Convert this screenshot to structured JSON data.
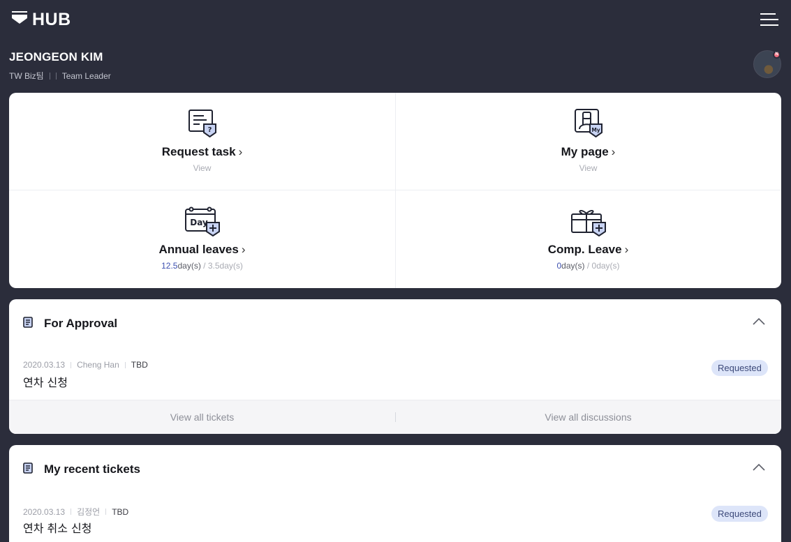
{
  "app": {
    "logo_text": "HUB",
    "logo_icon": "hub-logo-icon",
    "menu_icon": "hamburger-menu-icon"
  },
  "profile": {
    "name": "JEONGEON KIM",
    "team": "TW Biz팀",
    "role": "Team Leader",
    "avatar_badge": "N"
  },
  "quick_links": [
    {
      "title": "Request task",
      "sub": "View",
      "icon": "request-task-icon"
    },
    {
      "title": "My page",
      "sub": "View",
      "icon": "my-page-icon",
      "icon_text": "My"
    },
    {
      "title": "Annual leaves",
      "icon": "annual-leave-icon",
      "icon_text": "Day",
      "used": "12.5",
      "used_unit": "day(s)",
      "separator": "/",
      "total": "3.5day(s)"
    },
    {
      "title": "Comp. Leave",
      "icon": "comp-leave-gift-icon",
      "used": "0",
      "used_unit": "day(s)",
      "separator": "/",
      "total": "0day(s)"
    }
  ],
  "approval": {
    "title": "For Approval",
    "item": {
      "date": "2020.03.13",
      "person": "Cheng Han",
      "status_text": "TBD",
      "title": "연차 신청",
      "badge": "Requested"
    },
    "footer": {
      "left": "View all tickets",
      "right": "View all discussions"
    }
  },
  "recent": {
    "title": "My recent tickets",
    "item": {
      "date": "2020.03.13",
      "person": "김정언",
      "status_text": "TBD",
      "title": "연차 취소 신청",
      "badge": "Requested"
    }
  },
  "colors": {
    "background": "#2b2d3b",
    "accent": "#3c4fb0",
    "badge_bg": "#dde5f9",
    "notification": "#ef6b7d"
  }
}
